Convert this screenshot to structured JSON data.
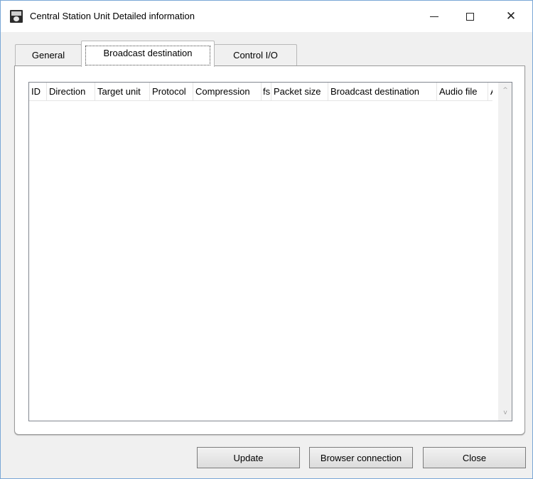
{
  "window": {
    "title": "Central Station Unit Detailed information",
    "minimize_icon": "minimize-icon",
    "maximize_icon": "maximize-icon",
    "close_glyph": "✕"
  },
  "tabs": [
    {
      "label": "General",
      "selected": false
    },
    {
      "label": "Broadcast destination",
      "selected": true
    },
    {
      "label": "Control I/O",
      "selected": false
    }
  ],
  "table": {
    "columns": [
      "ID",
      "Direction",
      "Target unit",
      "Protocol",
      "Compression",
      "fs",
      "Packet size",
      "Broadcast destination",
      "Audio file",
      "A"
    ],
    "rows": []
  },
  "scrollbar": {
    "up_glyph": "^",
    "down_glyph": "v"
  },
  "buttons": {
    "update": "Update",
    "browser_connection": "Browser connection",
    "close": "Close"
  }
}
